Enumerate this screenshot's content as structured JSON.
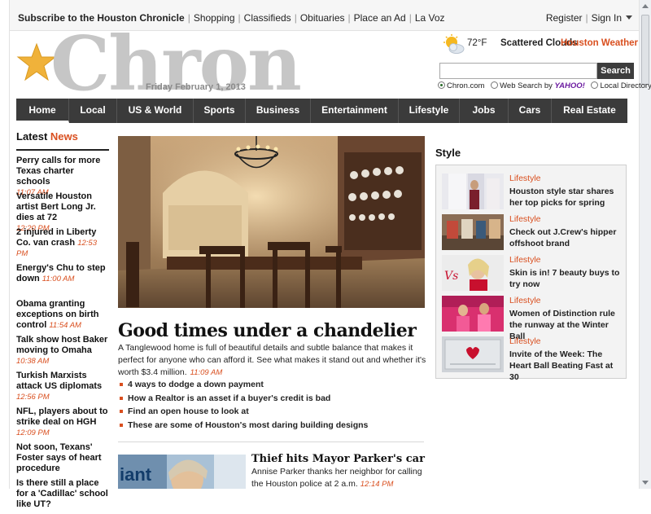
{
  "topbar": {
    "links": [
      "Subscribe to the Houston Chronicle",
      "Shopping",
      "Classifieds",
      "Obituaries",
      "Place an Ad",
      "La Voz"
    ],
    "register": "Register",
    "signin": "Sign In"
  },
  "masthead": {
    "logo_text": "Chron",
    "date": "Friday February 1, 2013"
  },
  "weather": {
    "temp": "72°F",
    "condition": "Scattered Clouds",
    "link": "Houston Weather"
  },
  "search": {
    "value": "",
    "placeholder": "",
    "button": "Search",
    "options": [
      {
        "label": "Chron.com",
        "selected": true
      },
      {
        "label_pre": "Web Search by",
        "label_brand": "YAHOO!",
        "selected": false
      },
      {
        "label": "Local Directory",
        "selected": false
      }
    ]
  },
  "nav": {
    "items": [
      "Home",
      "Local",
      "US & World",
      "Sports",
      "Business",
      "Entertainment",
      "Lifestyle",
      "Jobs",
      "Cars",
      "Real Estate"
    ],
    "active": "Home"
  },
  "latest": {
    "title_a": "Latest",
    "title_b": "News",
    "items": [
      {
        "text": "Perry calls for more Texas charter schools",
        "time": "11:07 AM"
      },
      {
        "text": "Versatile Houston artist Bert Long Jr. dies at 72",
        "time": "12:20 PM"
      },
      {
        "text": "2 injured in Liberty Co. van crash",
        "time": "12:53 PM"
      },
      {
        "text": "Energy's Chu to step down",
        "time": "11:00 AM"
      },
      {
        "text": "Obama granting exceptions on birth control",
        "time": "11:54 AM"
      },
      {
        "text": "Talk show host Baker moving to Omaha",
        "time": "10:38 AM"
      },
      {
        "text": "Turkish Marxists attack US diplomats",
        "time": "12:56 PM"
      },
      {
        "text": "NFL, players about to strike deal on HGH",
        "time": "12:09 PM"
      },
      {
        "text": "Not soon, Texans' Foster says of heart procedure",
        "time": ""
      },
      {
        "text": "Is there still a place for a 'Cadillac' school like UT?",
        "time": ""
      }
    ]
  },
  "main": {
    "headline": "Good times under a chandelier",
    "summary": "A Tanglewood home is full of beautiful details and subtle balance that makes it perfect for anyone who can afford it. See what makes it stand out and whether it's worth $3.4 million.",
    "summary_time": "11:09 AM",
    "bullets": [
      "4 ways to dodge a down payment",
      "How a Realtor is an asset if a buyer's credit is bad",
      "Find an open house to look at",
      "These are some of Houston's most daring building designs"
    ],
    "story2": {
      "title": "Thief hits Mayor Parker's car",
      "text": "Annise Parker thanks her neighbor for calling the Houston police at 2 a.m.",
      "time": "12:14 PM",
      "image_text": "iant"
    }
  },
  "style": {
    "title": "Style",
    "items": [
      {
        "category": "Lifestyle",
        "title": "Houston style star shares her top picks for spring"
      },
      {
        "category": "Lifestyle",
        "title": "Check out J.Crew's hipper offshoot brand"
      },
      {
        "category": "Lifestyle",
        "title": "Skin is in! 7 beauty buys to try now"
      },
      {
        "category": "Lifestyle",
        "title": "Women of Distinction rule the runway at the Winter Ball"
      },
      {
        "category": "Lifestyle",
        "title": "Invite of the Week: The Heart Ball Beating Fast at 30"
      }
    ]
  },
  "colors": {
    "accent": "#d94f1f",
    "nav_bg": "#3b3b3b",
    "logo": "#c6c6c6",
    "star": "#f0b23a"
  }
}
